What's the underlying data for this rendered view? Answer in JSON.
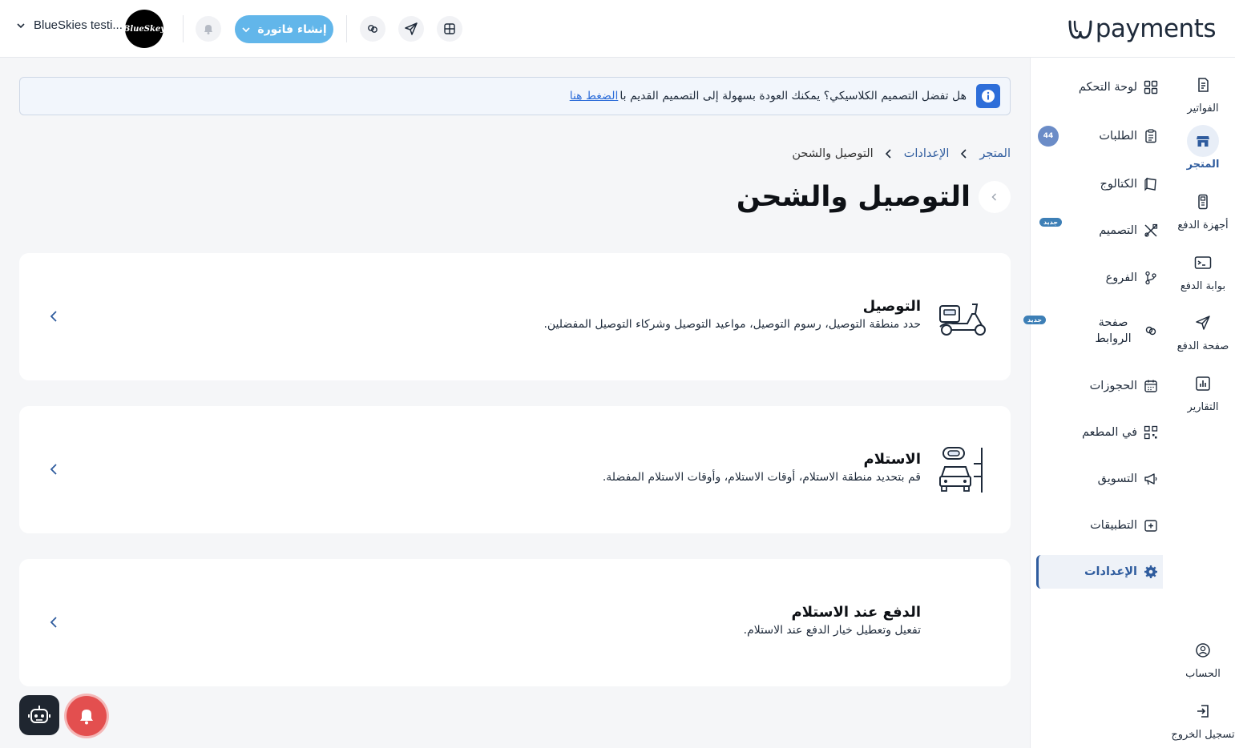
{
  "header": {
    "logo_text": "payments",
    "account_name": "BlueSkies testi...",
    "avatar_text": "BlueSkey",
    "create_invoice_label": "إنشاء فاتورة"
  },
  "rail": {
    "items": [
      {
        "label": "الفواتير"
      },
      {
        "label": "المتجر"
      },
      {
        "label": "أجهزة الدفع"
      },
      {
        "label": "بوابة الدفع"
      },
      {
        "label": "صفحة الدفع"
      },
      {
        "label": "التقارير"
      },
      {
        "label": "الحساب"
      },
      {
        "label": "تسجيل الخروج"
      }
    ]
  },
  "sidebar": {
    "items": [
      {
        "label": "لوحة التحكم"
      },
      {
        "label": "الطلبات",
        "count": "44"
      },
      {
        "label": "الكتالوج"
      },
      {
        "label": "التصميم",
        "badge": "جديد"
      },
      {
        "label": "الفروع"
      },
      {
        "label": "صفحة الروابط",
        "badge": "جديد"
      },
      {
        "label": "الحجوزات"
      },
      {
        "label": "في المطعم"
      },
      {
        "label": "التسويق"
      },
      {
        "label": "التطبيقات"
      },
      {
        "label": "الإعدادات"
      }
    ]
  },
  "banner": {
    "text": "هل تفضل التصميم الكلاسيكي؟ يمكنك العودة بسهولة إلى التصميم القديم با",
    "link": "الضغط هنا"
  },
  "breadcrumb": {
    "items": [
      "المتجر",
      "الإعدادات",
      "التوصيل والشحن"
    ]
  },
  "page": {
    "title": "التوصيل والشحن"
  },
  "cards": [
    {
      "title": "التوصيل",
      "description": "حدد منطقة التوصيل، رسوم التوصيل، مواعيد التوصيل وشركاء التوصيل المفضلين."
    },
    {
      "title": "الاستلام",
      "description": "قم بتحديد منطقة الاستلام، أوقات الاستلام، وأوقات الاستلام المفضلة."
    },
    {
      "title": "الدفع عند الاستلام",
      "description": "تفعيل وتعطيل خيار الدفع عند الاستلام."
    }
  ],
  "colors": {
    "accent": "#2f5c9e",
    "button": "#62b6ea",
    "info": "#2e6ed9",
    "notification": "#e34f4f"
  }
}
